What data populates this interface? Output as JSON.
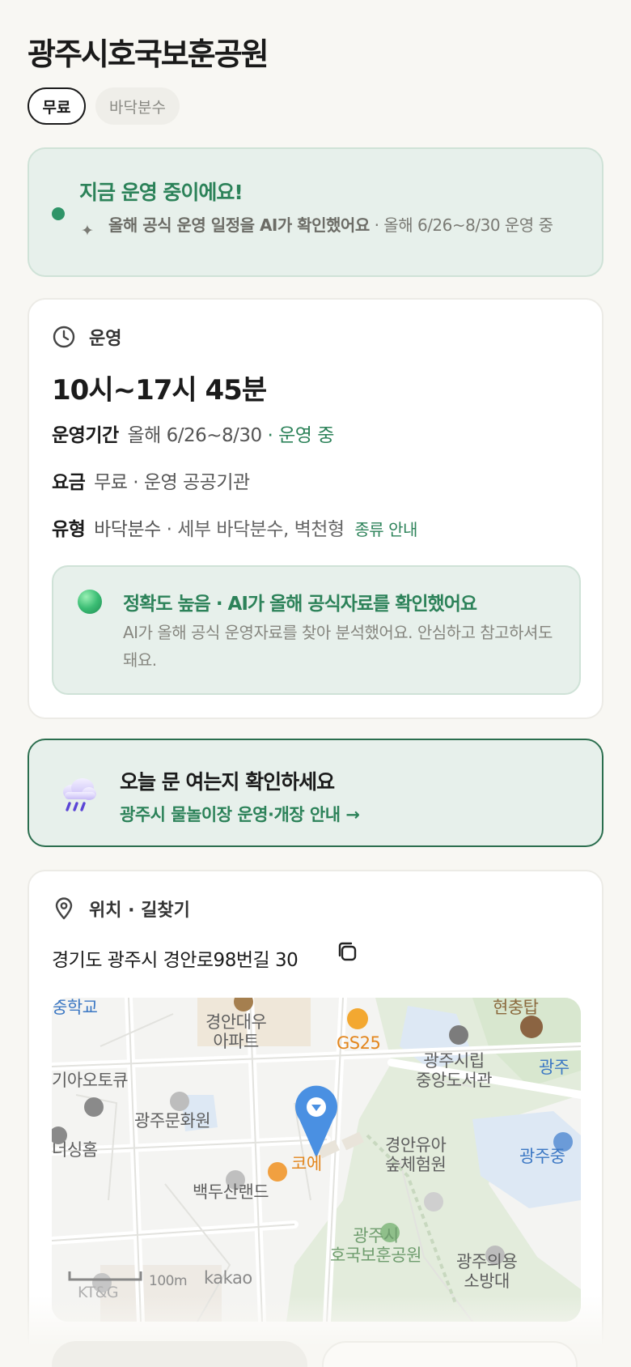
{
  "title": "광주시호국보훈공원",
  "chips": {
    "free": "무료",
    "type": "바닥분수"
  },
  "status": {
    "title": "지금 운영 중이에요!",
    "ai_note": "올해 공식 운영 일정을 AI가 확인했어요",
    "period_note": "· 올해 6/26~8/30 운영 중"
  },
  "operation": {
    "heading": "운영",
    "hours": "10시~17시 45분",
    "period_key": "운영기간",
    "period_value": "올해 6/26~8/30",
    "period_status": "· 운영 중",
    "fee_key": "요금",
    "fee_value": "무료 · 운영 공공기관",
    "type_key": "유형",
    "type_value": "바닥분수",
    "type_detail": "· 세부 바닥분수, 벽천형",
    "type_guide": "종류 안내"
  },
  "accuracy": {
    "title": "정확도 높음 · AI가 올해 공식자료를 확인했어요",
    "text": "AI가 올해 공식 운영자료를 찾아 분석했어요. 안심하고 참고하셔도 돼요."
  },
  "check": {
    "title": "오늘 문 여는지 확인하세요",
    "link": "광주시 물놀이장 운영·개장 안내 →"
  },
  "location": {
    "heading": "위치 · 길찾기",
    "address": "경기도 광주시 경안로98번길 30"
  },
  "map": {
    "labels": {
      "school": "중학교",
      "apartment": "경안대우\n아파트",
      "gs25": "GS25",
      "tower": "현충탑",
      "library": "광주시립\n중앙도서관",
      "city_right": "광주",
      "auto": "기아오토큐",
      "culture": "광주문화원",
      "housing": "너싱홈",
      "cafe": "코에",
      "forest": "경안유아\n숲체험원",
      "middle_right": "광주중",
      "baekdu": "백두산랜드",
      "park": "광주시\n호국보훈공원",
      "fire": "광주의용\n소방대",
      "scale": "100m",
      "kakao": "kakao",
      "ktg": "KT&G"
    }
  },
  "colors": {
    "accent": "#2c8259",
    "status_bg": "#e7f0eb",
    "border_dark": "#2b6e4e"
  }
}
